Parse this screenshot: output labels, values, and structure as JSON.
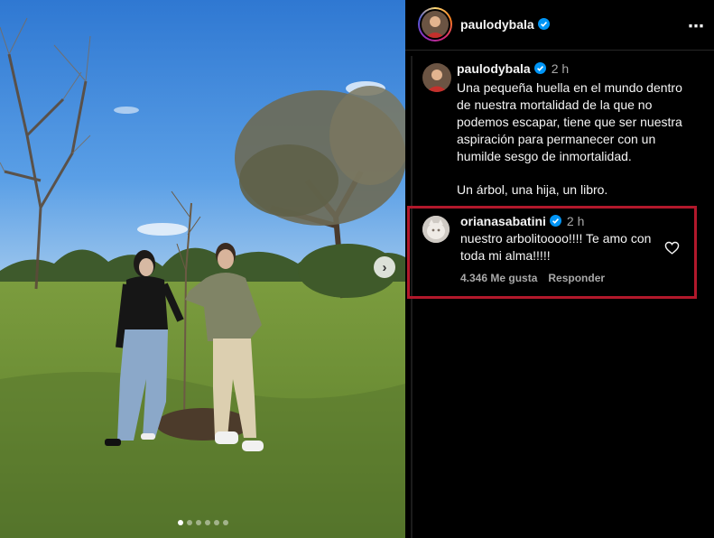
{
  "post": {
    "author": "paulodybala",
    "verified": true,
    "carousel": {
      "count": 6,
      "active_index": 0
    }
  },
  "caption": {
    "username": "paulodybala",
    "time": "2 h",
    "paragraph1": "Una pequeña huella en el mundo dentro de nuestra mortalidad de la que no podemos escapar, tiene que ser nuestra aspiración para permanecer con un humilde sesgo de inmortalidad.",
    "paragraph2": "Un árbol, una hija, un libro."
  },
  "comment": {
    "username": "orianasabatini",
    "time": "2 h",
    "text": "nuestro arbolitoooo!!!! Te amo con toda mi alma!!!!!",
    "likes": "4.346 Me gusta",
    "reply": "Responder",
    "highlight_color": "#b2182b"
  },
  "icons": {
    "next": "chevron-right-icon",
    "more": "more-options-icon",
    "like": "heart-outline-icon",
    "verified": "verified-badge-icon"
  },
  "colors": {
    "background": "#000000",
    "verified": "#0095f6",
    "muted_text": "#a8a8a8"
  }
}
